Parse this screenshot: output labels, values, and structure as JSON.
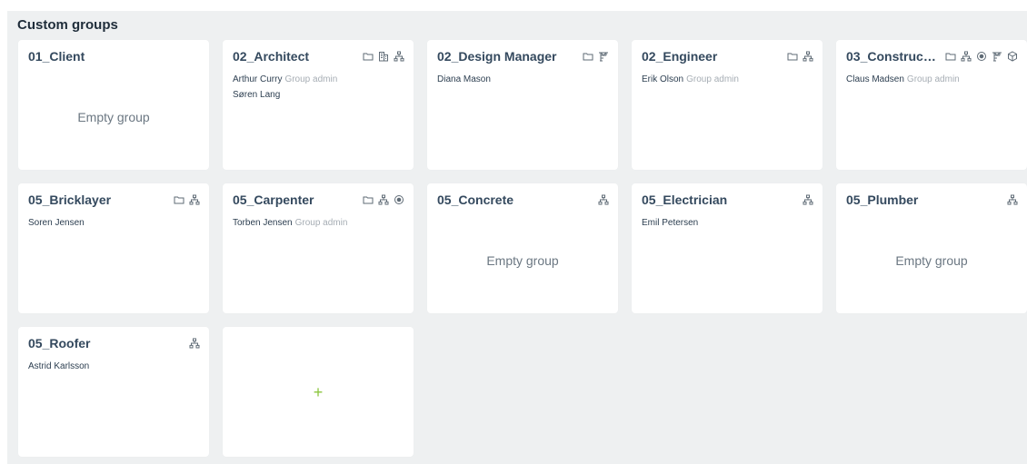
{
  "section": {
    "title": "Custom groups"
  },
  "empty_label": "Empty group",
  "add_label": "+",
  "cards": [
    {
      "title": "01_Client",
      "icons": [],
      "members": [],
      "empty": true
    },
    {
      "title": "02_Architect",
      "icons": [
        "folder-icon",
        "building-icon",
        "hierarchy-icon"
      ],
      "members": [
        {
          "name": "Arthur Curry",
          "role": "Group admin"
        },
        {
          "name": "Søren Lang",
          "role": ""
        }
      ]
    },
    {
      "title": "02_Design Manager",
      "icons": [
        "folder-icon",
        "crane-icon"
      ],
      "members": [
        {
          "name": "Diana Mason",
          "role": ""
        }
      ]
    },
    {
      "title": "02_Engineer",
      "icons": [
        "folder-icon",
        "hierarchy-icon"
      ],
      "members": [
        {
          "name": "Erik Olson",
          "role": "Group admin"
        }
      ]
    },
    {
      "title": "03_Constructi...",
      "icons": [
        "folder-icon",
        "hierarchy-icon",
        "target-icon",
        "crane-icon",
        "cube-icon"
      ],
      "members": [
        {
          "name": "Claus Madsen",
          "role": "Group admin"
        }
      ]
    },
    {
      "title": "05_Bricklayer",
      "icons": [
        "folder-icon",
        "hierarchy-icon"
      ],
      "members": [
        {
          "name": "Soren Jensen",
          "role": ""
        }
      ]
    },
    {
      "title": "05_Carpenter",
      "icons": [
        "folder-icon",
        "hierarchy-icon",
        "target-icon"
      ],
      "members": [
        {
          "name": "Torben Jensen",
          "role": "Group admin"
        }
      ]
    },
    {
      "title": "05_Concrete",
      "icons": [
        "hierarchy-icon"
      ],
      "members": [],
      "empty": true
    },
    {
      "title": "05_Electrician",
      "icons": [
        "hierarchy-icon"
      ],
      "members": [
        {
          "name": "Emil Petersen",
          "role": ""
        }
      ]
    },
    {
      "title": "05_Plumber",
      "icons": [
        "hierarchy-icon"
      ],
      "members": [],
      "empty": true
    },
    {
      "title": "05_Roofer",
      "icons": [
        "hierarchy-icon"
      ],
      "members": [
        {
          "name": "Astrid Karlsson",
          "role": ""
        }
      ]
    }
  ]
}
